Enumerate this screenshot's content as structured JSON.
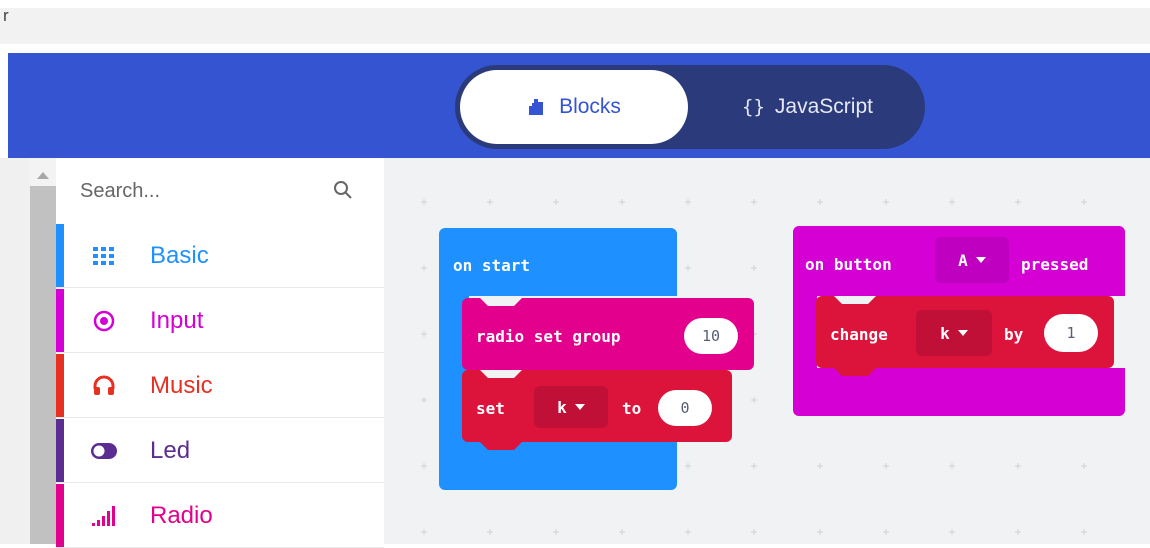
{
  "topbar": {
    "fragment": "r"
  },
  "header": {
    "tabs": [
      {
        "label": "Blocks",
        "icon": "puzzle-icon",
        "active": true
      },
      {
        "label": "JavaScript",
        "icon": "braces-icon",
        "active": false
      }
    ],
    "js_brace": "{}",
    "colors": {
      "header_bg": "#3454d1",
      "toggle_bg": "#2a3a7a"
    }
  },
  "toolbox": {
    "search_placeholder": "Search...",
    "categories": [
      {
        "label": "Basic",
        "color": "#1e90ff",
        "icon": "grid-icon"
      },
      {
        "label": "Input",
        "color": "#d400d4",
        "icon": "target-icon"
      },
      {
        "label": "Music",
        "color": "#e63022",
        "icon": "headphones-icon"
      },
      {
        "label": "Led",
        "color": "#5c2d91",
        "icon": "toggle-icon"
      },
      {
        "label": "Radio",
        "color": "#e3008c",
        "icon": "signal-bars-icon"
      }
    ]
  },
  "workspace": {
    "on_start": {
      "label": "on start",
      "color": "#1e90ff",
      "radio_set_group": {
        "label": "radio set group",
        "value": "10",
        "color": "#e3008c"
      },
      "set_var": {
        "label_set": "set",
        "var": "k",
        "label_to": "to",
        "value": "0",
        "color": "#dc143c"
      }
    },
    "on_button": {
      "label_on": "on button",
      "button": "A",
      "label_pressed": "pressed",
      "color": "#d400d4",
      "change": {
        "label": "change",
        "var": "k",
        "label_by": "by",
        "value": "1",
        "color": "#dc143c"
      }
    }
  }
}
